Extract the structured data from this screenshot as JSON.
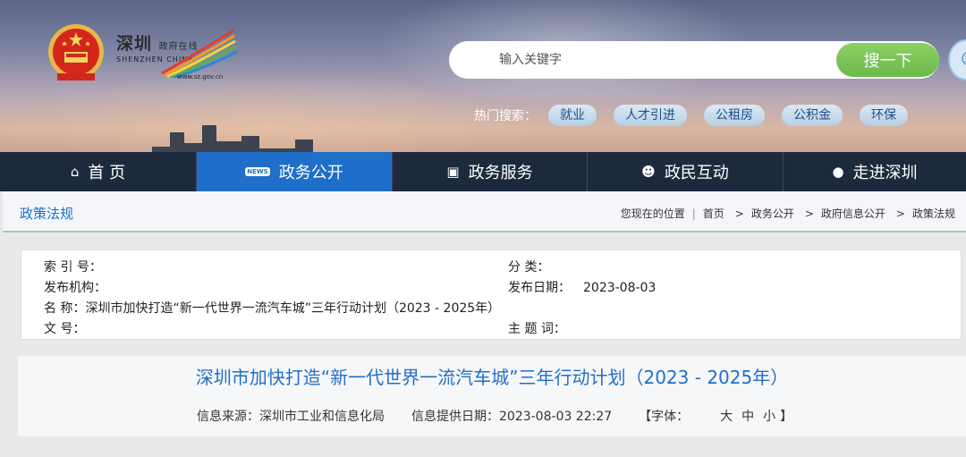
{
  "logo": {
    "cn": "深圳",
    "cn_small": "政府在线",
    "en": "SHENZHEN CHINA",
    "url": "www.sz.gov.cn"
  },
  "search": {
    "placeholder": "输入关键字",
    "button": "搜一下"
  },
  "hot_search": {
    "label": "热门搜索：",
    "tags": [
      "就业",
      "人才引进",
      "公租房",
      "公积金",
      "环保"
    ]
  },
  "nav": {
    "items": [
      {
        "label": "首 页",
        "icon": "home-icon"
      },
      {
        "label": "政务公开",
        "icon": "news-icon"
      },
      {
        "label": "政务服务",
        "icon": "monitor-icon"
      },
      {
        "label": "政民互动",
        "icon": "people-icon"
      },
      {
        "label": "走进深圳",
        "icon": "chat-icon"
      }
    ],
    "active_index": 1
  },
  "section_title": "政策法规",
  "breadcrumb": {
    "prefix": "您现在的位置",
    "items": [
      "首页",
      "政务公开",
      "政府信息公开",
      "政策法规"
    ]
  },
  "meta": {
    "index_label": "索 引 号：",
    "index_value": "",
    "category_label": "分    类：",
    "category_value": "",
    "org_label": "发布机构：",
    "org_value": "",
    "date_label": "发布日期：",
    "date_value": "2023-08-03",
    "name_label": "名    称：",
    "name_value": "深圳市加快打造“新一代世界一流汽车城”三年行动计划（2023 - 2025年）",
    "docno_label": "文    号：",
    "docno_value": "",
    "subject_label": "主 题 词：",
    "subject_value": ""
  },
  "doc": {
    "title": "深圳市加快打造“新一代世界一流汽车城”三年行动计划（2023 - 2025年）",
    "source": "信息来源：深圳市工业和信息化局",
    "provided_date": "信息提供日期：2023-08-03 22:27",
    "font_label": "【字体：",
    "font_large": "大",
    "font_medium": "中",
    "font_small": "小",
    "font_end": "】"
  }
}
